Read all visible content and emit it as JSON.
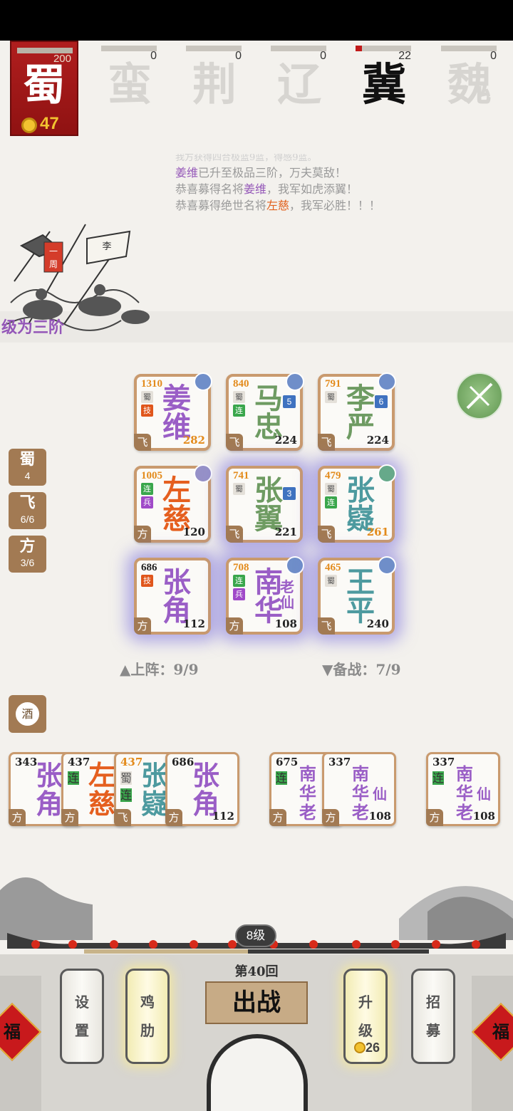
{
  "header": {
    "shu": {
      "name": "蜀",
      "score": "200",
      "gold": "47"
    },
    "factions": [
      {
        "name": "蛮",
        "score": "0",
        "progress": 0,
        "active": false
      },
      {
        "name": "荆",
        "score": "0",
        "progress": 0,
        "active": false
      },
      {
        "name": "辽",
        "score": "0",
        "progress": 0,
        "active": false
      },
      {
        "name": "冀",
        "score": "22",
        "progress": 0.11,
        "active": true
      },
      {
        "name": "魏",
        "score": "0",
        "progress": 0,
        "active": false
      }
    ]
  },
  "messages": {
    "faded": "我方获得四合极蓝9蓝，得感9蓝。",
    "line1": {
      "name": "姜维",
      "text": "已升至极品三阶，万夫莫敌！"
    },
    "line2": {
      "pre": "恭喜募得名将",
      "name": "姜维",
      "post": "，我军如虎添翼！"
    },
    "line3": {
      "pre": "恭喜募得绝世名将",
      "name": "左慈",
      "post": "，我军必胜！！！"
    }
  },
  "levelup_text": "级为三阶",
  "banner_text": "一周李",
  "side_tokens": [
    {
      "label": "蜀",
      "value": "4"
    },
    {
      "label": "飞",
      "value": "6/6"
    },
    {
      "label": "方",
      "value": "3/6"
    }
  ],
  "board": [
    {
      "power": "1310",
      "n1": "姜",
      "n2": "维",
      "num": "282",
      "type": "飞",
      "tags": [
        "蜀",
        "技"
      ]
    },
    {
      "power": "840",
      "n1": "马",
      "n2": "忠",
      "num": "224",
      "type": "飞",
      "tags": [
        "蜀",
        "连"
      ],
      "lvl": "5"
    },
    {
      "power": "791",
      "n1": "李",
      "n2": "严",
      "num": "224",
      "type": "飞",
      "tags": [
        "蜀"
      ],
      "lvl": "6"
    },
    {
      "power": "1005",
      "n1": "左",
      "n2": "慈",
      "num": "120",
      "type": "方",
      "tags": [
        "连",
        "兵"
      ]
    },
    {
      "power": "741",
      "n1": "张",
      "n2": "翼",
      "num": "221",
      "type": "飞",
      "tags": [
        "蜀"
      ],
      "lvl": "3"
    },
    {
      "power": "479",
      "n1": "张",
      "n2": "嶷",
      "num": "261",
      "type": "飞",
      "tags": [
        "蜀",
        "连"
      ]
    },
    {
      "power": "686",
      "n1": "张",
      "n2": "角",
      "num": "112",
      "type": "方",
      "tags": [
        "技"
      ]
    },
    {
      "power": "708",
      "n1": "南",
      "n2": "华",
      "n3": "老仙",
      "num": "108",
      "type": "方",
      "tags": [
        "连",
        "兵"
      ]
    },
    {
      "power": "465",
      "n1": "王",
      "n2": "平",
      "num": "240",
      "type": "飞",
      "tags": [
        "蜀"
      ]
    }
  ],
  "deploy_label": "▲上阵：9/9",
  "reserve_label": "▼备战：7/9",
  "wine_label": "酒",
  "bench": [
    {
      "power": "343",
      "n1": "张",
      "n2": "角",
      "type": "方"
    },
    {
      "power": "437",
      "n1": "左",
      "n2": "慈",
      "type": "方",
      "tags": [
        "连"
      ]
    },
    {
      "power": "437",
      "n1": "张",
      "n2": "嶷",
      "type": "飞",
      "tags": [
        "蜀",
        "连"
      ]
    },
    {
      "power": "686",
      "n1": "张",
      "n2": "角",
      "num": "112",
      "type": "方"
    },
    {
      "power": "675",
      "s1": "南",
      "s2": "华",
      "s3": "老",
      "type": "方",
      "tags": [
        "连"
      ]
    },
    {
      "power": "337",
      "s1": "南",
      "s2": "华",
      "s3": "老",
      "n3": "仙",
      "num": "108",
      "type": "方"
    },
    {
      "power": "337",
      "s1": "南",
      "s2": "华",
      "s3": "老",
      "n3": "仙",
      "num": "108",
      "type": "方",
      "tags": [
        "连"
      ]
    }
  ],
  "bottom": {
    "rank": "8级",
    "round": "第40回",
    "fight": "出战",
    "buttons": [
      {
        "c1": "设",
        "c2": "置"
      },
      {
        "c1": "鸡",
        "c2": "肋"
      },
      {
        "c1": "升",
        "c2": "级",
        "cost": "26"
      },
      {
        "c1": "招",
        "c2": "募"
      }
    ],
    "fu": "福"
  },
  "colors": {
    "shu_red": "#b01e1e",
    "card_border": "#c99a6e",
    "gold": "#f2c230",
    "purple": "#9457b8",
    "orange": "#e1601c"
  }
}
